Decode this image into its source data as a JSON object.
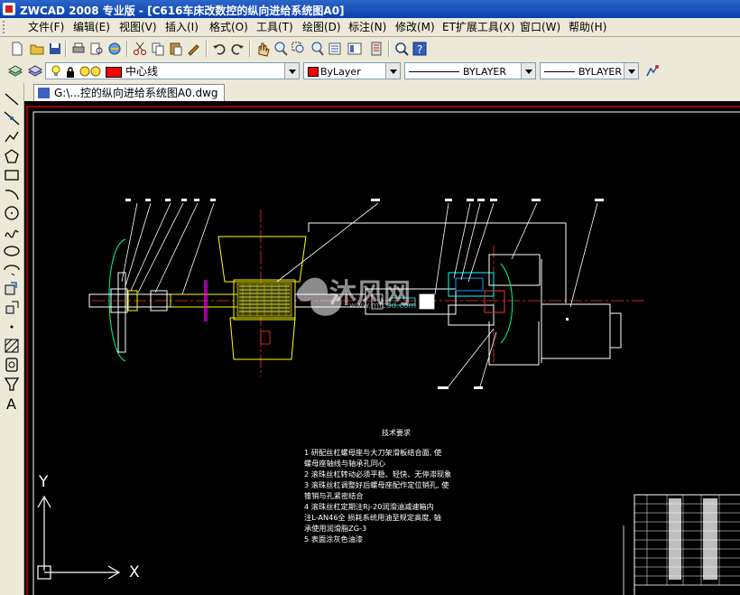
{
  "window": {
    "title": "ZWCAD 2008 专业版 - [C616车床改数控的纵向进给系统图A0]"
  },
  "menu": {
    "items": [
      {
        "label": "文件(F)",
        "name": "menu-file"
      },
      {
        "label": "编辑(E)",
        "name": "menu-edit"
      },
      {
        "label": "视图(V)",
        "name": "menu-view"
      },
      {
        "label": "插入(I)",
        "name": "menu-insert"
      },
      {
        "label": "格式(O)",
        "name": "menu-format"
      },
      {
        "label": "工具(T)",
        "name": "menu-tools"
      },
      {
        "label": "绘图(D)",
        "name": "menu-draw"
      },
      {
        "label": "标注(N)",
        "name": "menu-dimension"
      },
      {
        "label": "修改(M)",
        "name": "menu-modify"
      },
      {
        "label": "ET扩展工具(X)",
        "name": "menu-et"
      },
      {
        "label": "窗口(W)",
        "name": "menu-window"
      },
      {
        "label": "帮助(H)",
        "name": "menu-help"
      }
    ]
  },
  "layer_bar": {
    "layer": "中心线",
    "layer_color": "#ff0000",
    "color": "ByLayer",
    "linetype": "BYLAYER",
    "lineweight": "BYLAYER"
  },
  "document": {
    "tab_label": "G:\\...控的纵向进给系统图A0.dwg"
  },
  "drawing": {
    "tech_title": "技术要求",
    "tech_lines": [
      "1 研配丝杠螺母座与大刀架滑板结合面, 使",
      "螺母座轴线与轴承孔同心",
      "2 滚珠丝杠转动必须平稳、轻快、无停滞现象",
      "3 滚珠丝杠调整好后螺母座配作定位销孔, 使",
      "锥销与孔紧密结合",
      "4 滚珠丝杠定期注Rj-20润滑油减速箱内",
      "注L-AN46全    损耗系统用油至规定高度, 轴",
      "承使用润滑脂ZG-3",
      "5 表面涂灰色油漆"
    ],
    "ucs_x": "X",
    "ucs_y": "Y",
    "watermark": "沐风网",
    "watermark_url": "www.mfcad.com"
  },
  "colors": {
    "canvas_bg": "#000000",
    "border_red": "#ff0000",
    "yellow": "#ffff00",
    "cyan": "#00ffff",
    "magenta": "#ff00ff",
    "white": "#ffffff"
  }
}
